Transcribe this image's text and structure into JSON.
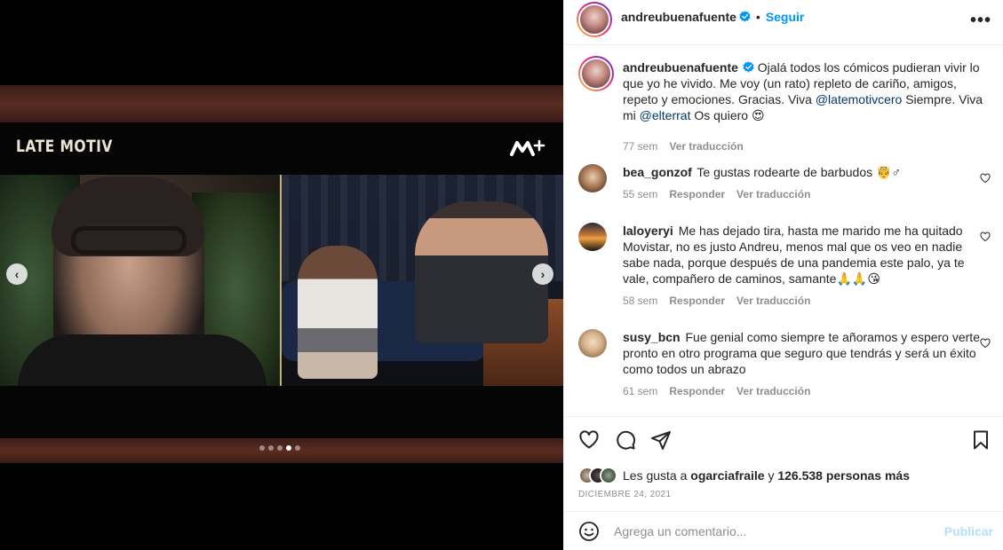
{
  "media": {
    "show_logo": "LATE MOTIV",
    "channel_logo": "M+",
    "carousel": {
      "total": 5,
      "active_index": 3
    }
  },
  "post": {
    "author": "andreubuenafuente",
    "bullet": "•",
    "follow_label": "Seguir",
    "more_label": "•••",
    "caption": {
      "part1": "Ojalá todos los cómicos pudieran vivir lo que yo he vivido. Me voy (un rato) repleto de cariño, amigos, repeto y emociones. Gracias. Viva ",
      "mention1": "@latemotivcero",
      "part2": " Siempre. Viva mi ",
      "mention2": "@elterrat",
      "part3": " Os quiero 😍",
      "age": "77 sem",
      "translate": "Ver traducción"
    }
  },
  "comments": [
    {
      "user": "bea_gonzof",
      "text": "Te gustas rodearte de barbudos 🤴♂",
      "age": "55 sem",
      "reply": "Responder",
      "translate": "Ver traducción"
    },
    {
      "user": "laloyeryi",
      "text": "Me has dejado tira, hasta me marido me ha quitado Movistar, no es justo Andreu, menos mal que os veo en nadie sabe nada, porque después de una pandemia este palo, ya te vale, compañero de caminos, samante🙏🙏😘",
      "age": "58 sem",
      "reply": "Responder",
      "translate": "Ver traducción"
    },
    {
      "user": "susy_bcn",
      "text": "Fue genial como siempre te añoramos y espero verte pronto en otro programa que seguro que tendrás y será un éxito como todos un abrazo",
      "age": "61 sem",
      "reply": "Responder",
      "translate": "Ver traducción"
    }
  ],
  "likes": {
    "prefix": "Les gusta a",
    "user": "ogarciafraile",
    "joiner": "y",
    "count_text": "126.538 personas más"
  },
  "date": "DICIEMBRE 24, 2021",
  "add_comment": {
    "placeholder": "Agrega un comentario...",
    "publish_label": "Publicar"
  },
  "colors": {
    "accent": "#0095f6",
    "mention": "#00376b",
    "muted": "#8e8e8e",
    "publish_disabled": "#b2dffc"
  },
  "icons": [
    "chevron-left-icon",
    "chevron-right-icon",
    "verified-badge-icon",
    "more-options-icon",
    "heart-icon",
    "comment-icon",
    "share-icon",
    "bookmark-icon",
    "emoji-icon"
  ]
}
